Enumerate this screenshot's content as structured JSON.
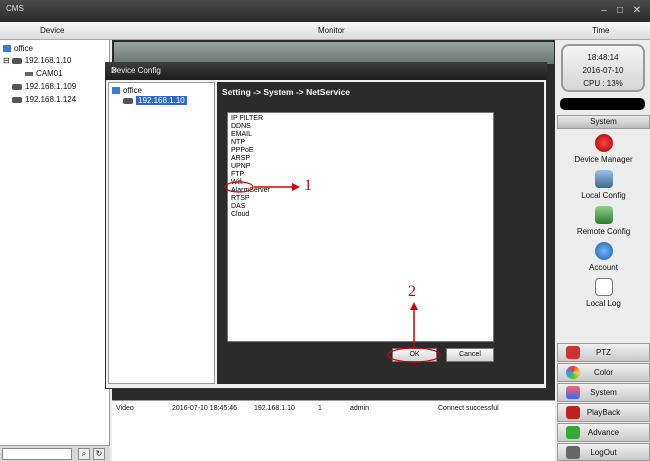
{
  "window": {
    "title": "CMS",
    "min": "–",
    "max": "□",
    "close": "✕"
  },
  "header": {
    "device": "Device",
    "monitor": "Monitor",
    "time": "Time"
  },
  "tree": {
    "root": "office",
    "expander": "⊟",
    "devices": [
      {
        "label": "192.168.1.10",
        "children": [
          "CAM01"
        ]
      },
      {
        "label": "192.168.1.109"
      },
      {
        "label": "192.168.1.124"
      }
    ]
  },
  "clock": {
    "time": "18:48:14",
    "date": "2016-07-10",
    "cpu": "CPU : 13%"
  },
  "right_panel": {
    "section_title": "System",
    "tools": [
      "Device Manager",
      "Local Config",
      "Remote Config",
      "Account",
      "Local Log"
    ],
    "buttons": [
      "PTZ",
      "Color",
      "System",
      "PlayBack",
      "Advance",
      "LogOut"
    ]
  },
  "log": {
    "row": [
      "Video",
      "2016-07-10 18:45:46",
      "192.168.1.10",
      "1",
      "admin",
      "Connect successful"
    ]
  },
  "dialog": {
    "title": "Device Config",
    "close": "✕",
    "tree_root": "office",
    "tree_device": "192.168.1.10",
    "breadcrumb": "Setting -> System -> NetService",
    "services": [
      "IP FILTER",
      "DDNS",
      "EMAIL",
      "NTP",
      "PPPoE",
      "ARSP",
      "UPNP",
      "FTP",
      "Wifi",
      "AlarmServer",
      "RTSP",
      "DAS",
      "Cloud"
    ],
    "ok_label": "OK",
    "cancel_label": "Cancel"
  },
  "annotations": {
    "step1": "1",
    "step2": "2"
  },
  "colors": {
    "annotation": "#d00000",
    "selection": "#316ac5"
  }
}
